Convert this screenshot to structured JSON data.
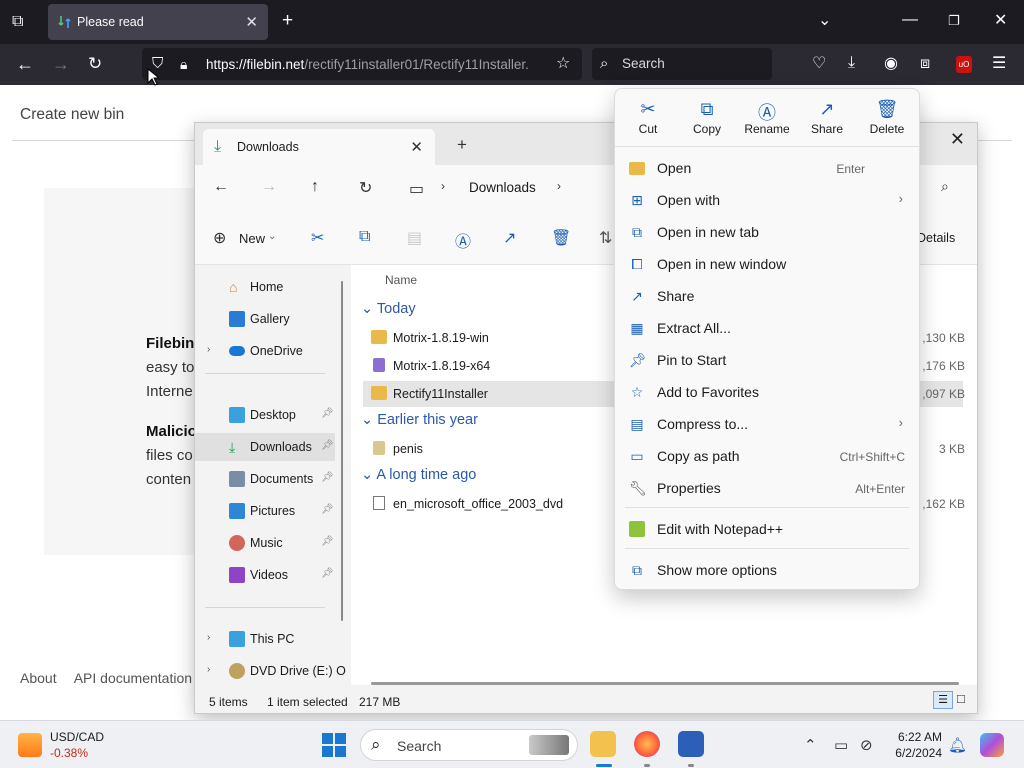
{
  "browser": {
    "tab_title": "Please read",
    "url_host": "https://filebin.net",
    "url_path": "/rectify11installer01/Rectify11Installer.",
    "search_placeholder": "Search"
  },
  "webpage": {
    "create_bin": "Create new bin",
    "text_lines": [
      "Filebin",
      "easy to",
      "Interne",
      "Malicio",
      "files co",
      "conten"
    ],
    "footer": [
      "About",
      "API documentation"
    ]
  },
  "explorer": {
    "tab_title": "Downloads",
    "breadcrumb": "Downloads",
    "toolbar": {
      "new_label": "New",
      "details_label": "Details"
    },
    "nav": [
      {
        "label": "Home"
      },
      {
        "label": "Gallery"
      },
      {
        "label": "OneDrive"
      },
      {
        "label": "Desktop"
      },
      {
        "label": "Downloads"
      },
      {
        "label": "Documents"
      },
      {
        "label": "Pictures"
      },
      {
        "label": "Music"
      },
      {
        "label": "Videos"
      },
      {
        "label": "This PC"
      },
      {
        "label": "DVD Drive (E:) O"
      }
    ],
    "column_name": "Name",
    "groups": [
      "Today",
      "Earlier this year",
      "A long time ago"
    ],
    "files": [
      {
        "name": "Motrix-1.8.19-win",
        "size": ",130 KB"
      },
      {
        "name": "Motrix-1.8.19-x64",
        "size": ",176 KB"
      },
      {
        "name": "Rectify11Installer",
        "size": ",097 KB"
      },
      {
        "name": "penis",
        "size": "3 KB"
      },
      {
        "name": "en_microsoft_office_2003_dvd",
        "size": ",162 KB"
      }
    ],
    "status": {
      "items": "5 items",
      "selected": "1 item selected",
      "size": "217 MB"
    }
  },
  "context_menu": {
    "quick_actions": [
      {
        "label": "Cut",
        "icon": "scissors-icon"
      },
      {
        "label": "Copy",
        "icon": "copy-icon"
      },
      {
        "label": "Rename",
        "icon": "rename-icon"
      },
      {
        "label": "Share",
        "icon": "share-icon"
      },
      {
        "label": "Delete",
        "icon": "trash-icon"
      }
    ],
    "items": [
      {
        "label": "Open",
        "shortcut": "Enter"
      },
      {
        "label": "Open with",
        "shortcut": ""
      },
      {
        "label": "Open in new tab",
        "shortcut": ""
      },
      {
        "label": "Open in new window",
        "shortcut": ""
      },
      {
        "label": "Share",
        "shortcut": ""
      },
      {
        "label": "Extract All...",
        "shortcut": ""
      },
      {
        "label": "Pin to Start",
        "shortcut": ""
      },
      {
        "label": "Add to Favorites",
        "shortcut": ""
      },
      {
        "label": "Compress to...",
        "shortcut": ""
      },
      {
        "label": "Copy as path",
        "shortcut": "Ctrl+Shift+C"
      },
      {
        "label": "Properties",
        "shortcut": "Alt+Enter"
      },
      {
        "label": "Edit with Notepad++",
        "shortcut": ""
      },
      {
        "label": "Show more options",
        "shortcut": ""
      }
    ]
  },
  "taskbar": {
    "ticker_name": "USD/CAD",
    "ticker_change": "-0.38%",
    "search_placeholder": "Search",
    "time": "6:22 AM",
    "date": "6/2/2024"
  }
}
